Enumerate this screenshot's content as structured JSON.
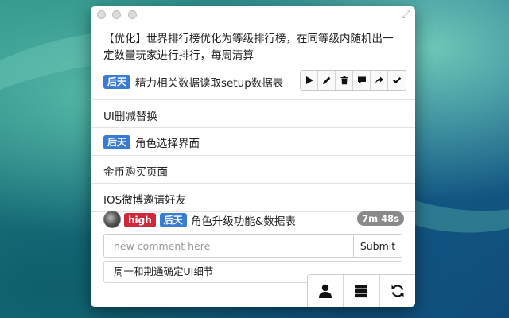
{
  "background": {
    "name": "ocean-wallpaper"
  },
  "window": {
    "items": {
      "r1": {
        "text": "【优化】世界排行榜优化为等级排行榜，在同等级内随机出一定数量玩家进行排行，每周清算"
      },
      "r2": {
        "badge": "后天",
        "text": "精力相关数据读取setup数据表"
      },
      "r3": {
        "text": "UI删减替换"
      },
      "r4": {
        "badge": "后天",
        "text": "角色选择界面"
      },
      "r5": {
        "text": "金币购买页面"
      },
      "r6": {
        "text": "IOS微博邀请好友"
      },
      "r7": {
        "priority": "high",
        "badge": "后天",
        "text": "角色升级功能&数据表",
        "timer": "7m 48s"
      }
    },
    "toolbar_icons": [
      "play-icon",
      "pencil-icon",
      "trash-icon",
      "comment-icon",
      "share-icon",
      "check-icon"
    ],
    "comment": {
      "placeholder": "new comment here",
      "submit_label": "Submit"
    },
    "note": "周一和荆通确定UI细节",
    "bottom_icons": [
      "user-icon",
      "server-icon",
      "refresh-icon"
    ],
    "colors": {
      "badge_blue": "#3a7ccf",
      "badge_red": "#d0283b",
      "timer_gray": "#8a8a8a"
    }
  }
}
